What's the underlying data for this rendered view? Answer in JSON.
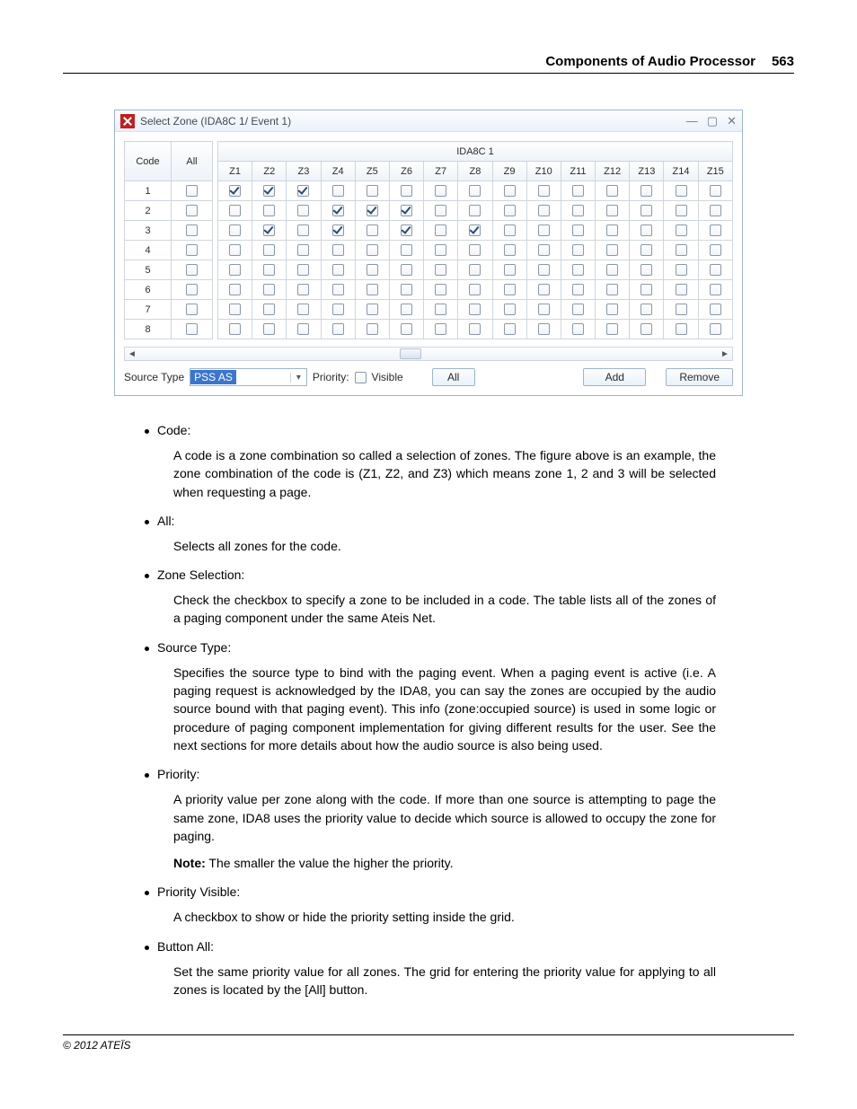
{
  "header": {
    "title": "Components of Audio Processor",
    "page": "563"
  },
  "window": {
    "title": "Select Zone (IDA8C 1/ Event 1)",
    "group_header": "IDA8C 1",
    "cols": {
      "code": "Code",
      "all": "All"
    },
    "zone_labels": [
      "Z1",
      "Z2",
      "Z3",
      "Z4",
      "Z5",
      "Z6",
      "Z7",
      "Z8",
      "Z9",
      "Z10",
      "Z11",
      "Z12",
      "Z13",
      "Z14",
      "Z15"
    ],
    "rows": [
      {
        "code": "1",
        "all": false,
        "zones": [
          true,
          true,
          true,
          false,
          false,
          false,
          false,
          false,
          false,
          false,
          false,
          false,
          false,
          false,
          false
        ]
      },
      {
        "code": "2",
        "all": false,
        "zones": [
          false,
          false,
          false,
          true,
          true,
          true,
          false,
          false,
          false,
          false,
          false,
          false,
          false,
          false,
          false
        ]
      },
      {
        "code": "3",
        "all": false,
        "zones": [
          false,
          true,
          false,
          true,
          false,
          true,
          false,
          true,
          false,
          false,
          false,
          false,
          false,
          false,
          false
        ]
      },
      {
        "code": "4",
        "all": false,
        "zones": [
          false,
          false,
          false,
          false,
          false,
          false,
          false,
          false,
          false,
          false,
          false,
          false,
          false,
          false,
          false
        ]
      },
      {
        "code": "5",
        "all": false,
        "zones": [
          false,
          false,
          false,
          false,
          false,
          false,
          false,
          false,
          false,
          false,
          false,
          false,
          false,
          false,
          false
        ]
      },
      {
        "code": "6",
        "all": false,
        "zones": [
          false,
          false,
          false,
          false,
          false,
          false,
          false,
          false,
          false,
          false,
          false,
          false,
          false,
          false,
          false
        ]
      },
      {
        "code": "7",
        "all": false,
        "zones": [
          false,
          false,
          false,
          false,
          false,
          false,
          false,
          false,
          false,
          false,
          false,
          false,
          false,
          false,
          false
        ]
      },
      {
        "code": "8",
        "all": false,
        "zones": [
          false,
          false,
          false,
          false,
          false,
          false,
          false,
          false,
          false,
          false,
          false,
          false,
          false,
          false,
          false
        ]
      }
    ],
    "toolbar": {
      "source_type_label": "Source Type",
      "source_type_value": "PSS AS",
      "priority_label": "Priority:",
      "visible_label": "Visible",
      "visible_checked": false,
      "all_button": "All",
      "add_button": "Add",
      "remove_button": "Remove"
    }
  },
  "doc": {
    "items": [
      {
        "title": "Code:",
        "body": [
          "A code is a zone combination so called a selection of zones. The figure above is an example, the zone combination of the code is (Z1, Z2, and Z3) which means zone 1, 2 and 3 will be selected when requesting a page."
        ]
      },
      {
        "title": "All:",
        "body": [
          "Selects all zones for the code."
        ]
      },
      {
        "title": "Zone Selection:",
        "body": [
          "Check the checkbox to specify a zone to be included in a code. The table lists all of the zones of a paging component under the same Ateis Net."
        ]
      },
      {
        "title": "Source Type:",
        "body": [
          "Specifies the source type to bind with the paging event. When a paging event is active (i.e. A paging request is acknowledged by the IDA8, you can say the zones are occupied by the audio source bound with that paging event). This info (zone:occupied source) is used in some logic or procedure of paging component implementation for giving different results for the user. See the next sections for more details about how the audio source is also being used."
        ]
      },
      {
        "title": "Priority:",
        "body": [
          "A priority value per zone along with the code. If more than one source is attempting to page the same zone, IDA8 uses the priority value to decide which source is allowed to occupy the zone for paging."
        ],
        "note": "The smaller the value the higher the priority."
      },
      {
        "title": "Priority Visible:",
        "body": [
          "A checkbox to show or hide the priority setting inside the grid."
        ]
      },
      {
        "title": "Button All:",
        "body": [
          "Set the same priority value for all zones. The grid for entering the priority value for applying to all zones is located by the [All] button."
        ]
      }
    ]
  },
  "footer": "© 2012 ATEÏS"
}
